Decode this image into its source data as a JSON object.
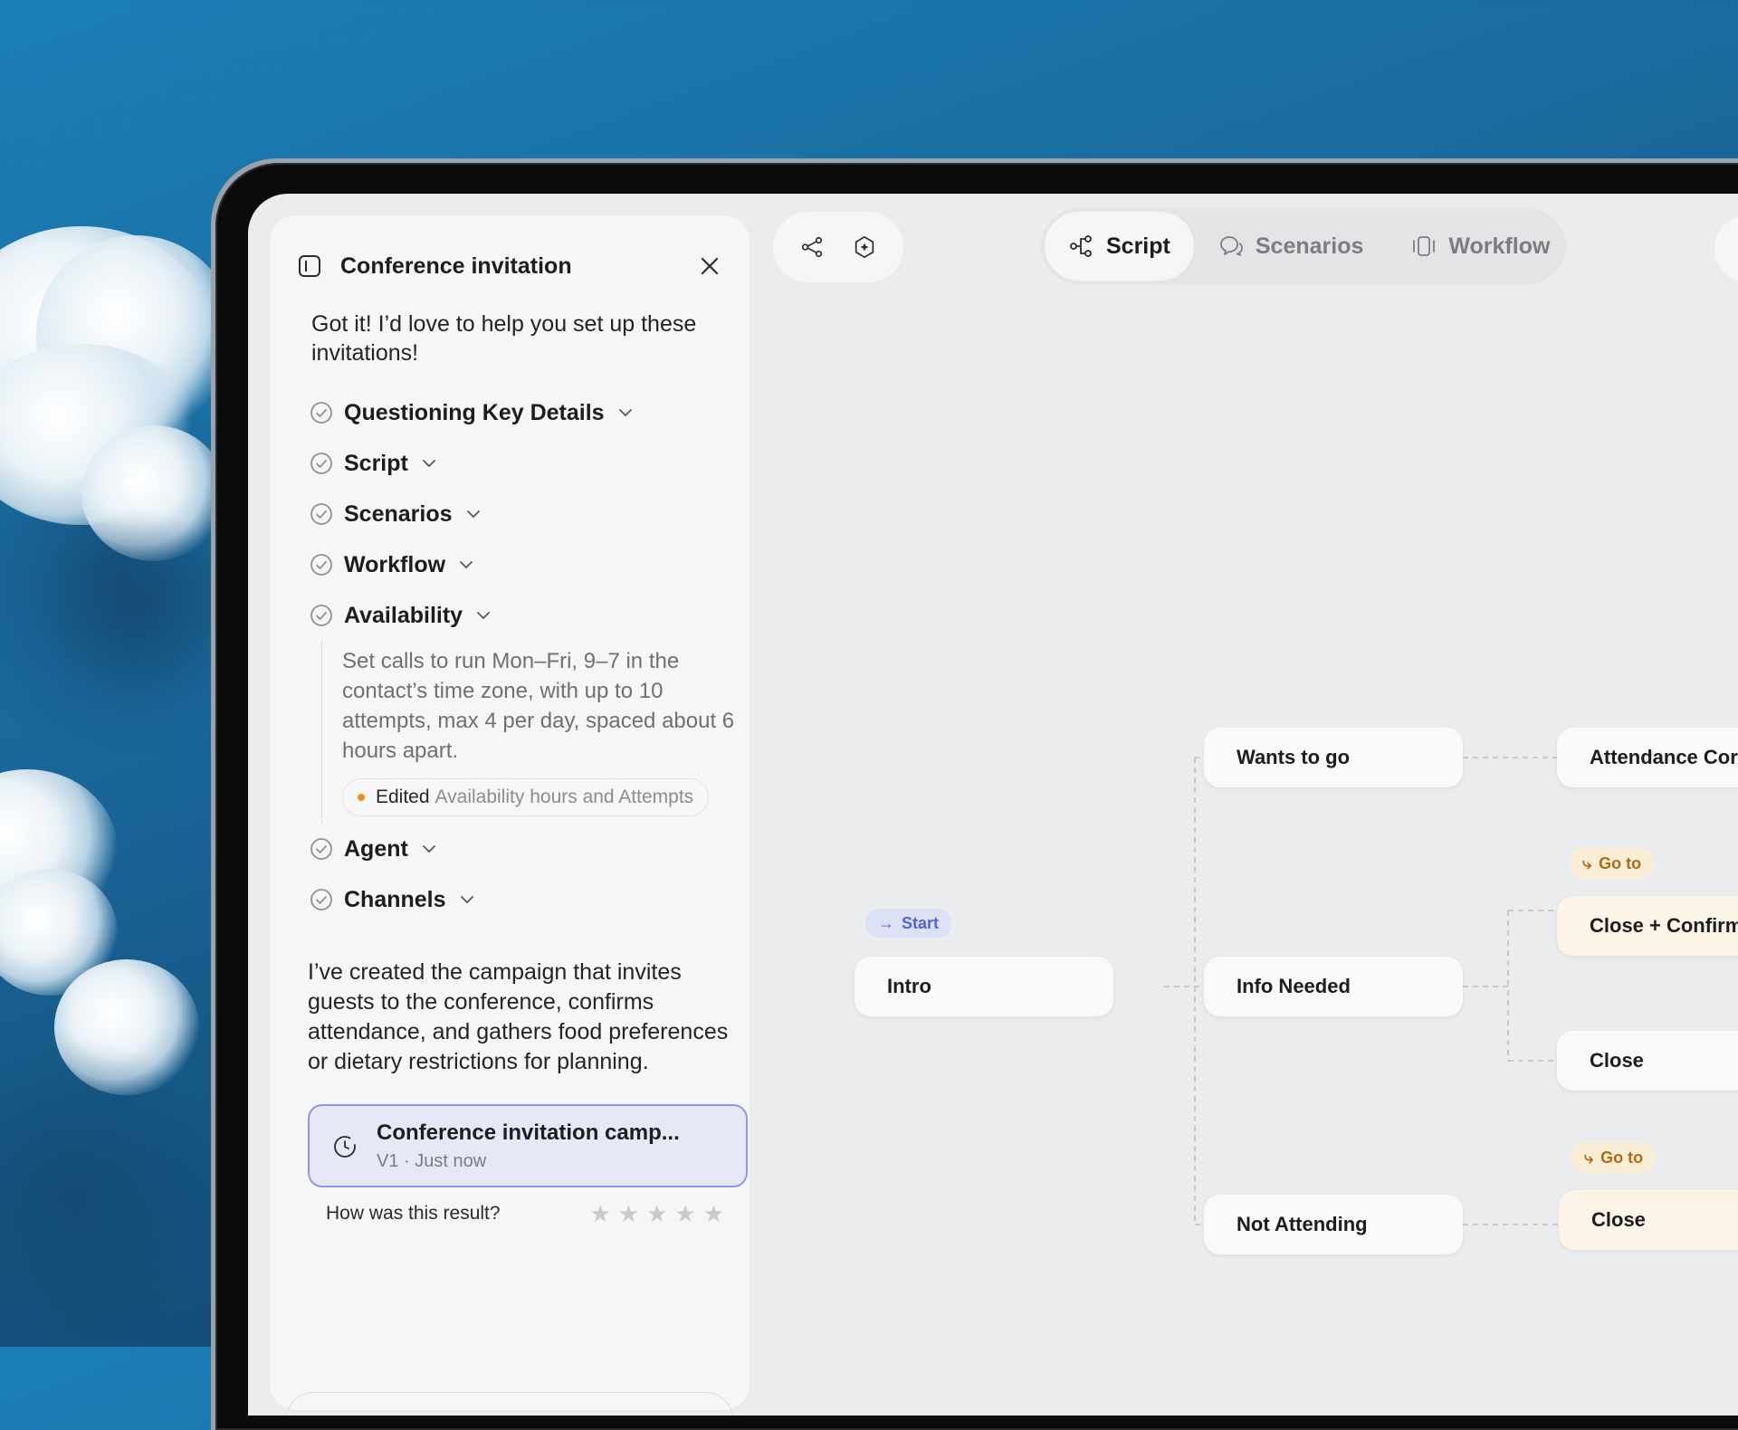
{
  "panel": {
    "title": "Conference invitation",
    "intro": "Got it! I’d love to help you set up these invitations!",
    "steps": [
      {
        "label": "Questioning Key Details"
      },
      {
        "label": "Script"
      },
      {
        "label": "Scenarios"
      },
      {
        "label": "Workflow"
      },
      {
        "label": "Availability"
      },
      {
        "label": "Agent"
      },
      {
        "label": "Channels"
      }
    ],
    "availability_detail": "Set calls to run Mon–Fri, 9–7 in the contact’s time zone, with up to 10 attempts, max 4 per day, spaced about 6 hours apart.",
    "edited": {
      "strong": "Edited",
      "muted": "Availability hours and Attempts"
    },
    "summary": "I’ve created the campaign that invites guests to the conference, confirms attendance, and gathers food preferences or dietary restrictions for planning.",
    "artifact": {
      "title": "Conference invitation camp...",
      "meta": "V1 · Just now"
    },
    "rating": {
      "question": "How was this result?",
      "stars": 5,
      "filled": 0
    }
  },
  "tabs": [
    {
      "label": "Script",
      "icon": "flow-icon",
      "active": true
    },
    {
      "label": "Scenarios",
      "icon": "chat-bubbles-icon",
      "active": false
    },
    {
      "label": "Workflow",
      "icon": "workflow-icon",
      "active": false
    }
  ],
  "canvas": {
    "start_badge": "Start",
    "goto_label": "Go to",
    "nodes": {
      "intro": "Intro",
      "wants_to_go": "Wants to go",
      "info_needed": "Info Needed",
      "not_attending": "Not Attending",
      "attendance": "Attendance Cor",
      "close_confirm": "Close + Confirm",
      "close_a": "Close",
      "close_b": "Close"
    }
  },
  "colors": {
    "accent": "#5363d0",
    "warning": "#f28a1c",
    "goto": "#b06a12"
  }
}
